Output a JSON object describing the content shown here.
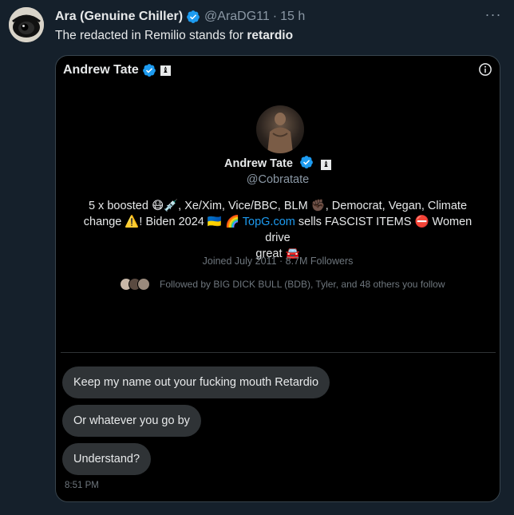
{
  "tweet": {
    "author_name": "Ara (Genuine Chiller)",
    "author_handle": "@AraDG11",
    "separator": "·",
    "time": "15 h",
    "text_prefix": "The redacted in Remilio stands for ",
    "text_bold": "retardio",
    "more_label": "···"
  },
  "card": {
    "name": "Andrew Tate",
    "tag_glyph": "♝",
    "profile": {
      "name": "Andrew Tate",
      "handle": "@Cobratate",
      "bio_line1": "5 x boosted 😷💉, Xe/Xim, Vice/BBC, BLM ✊🏿, Democrat, Vegan, Climate",
      "bio_line2_a": "change ⚠️! Biden 2024 🇺🇦 🌈 ",
      "bio_link": "TopG.com",
      "bio_line2_b": " sells FASCIST ITEMS ⛔ Women drive",
      "bio_line3": "great 🚘",
      "joined": "Joined July 2011 · 8.7M Followers",
      "followed_by": "Followed by BIG DICK BULL (BDB), Tyler, and 48 others you follow"
    },
    "messages": [
      "Keep my name out your fucking mouth Retardio",
      "Or whatever you go by",
      "Understand?"
    ],
    "message_time": "8:51 PM"
  },
  "colors": {
    "background": "#15202b",
    "card_background": "#000000",
    "verified_blue": "#1d9bf0",
    "bubble": "#2f3336",
    "muted_text": "#8b98a5"
  }
}
